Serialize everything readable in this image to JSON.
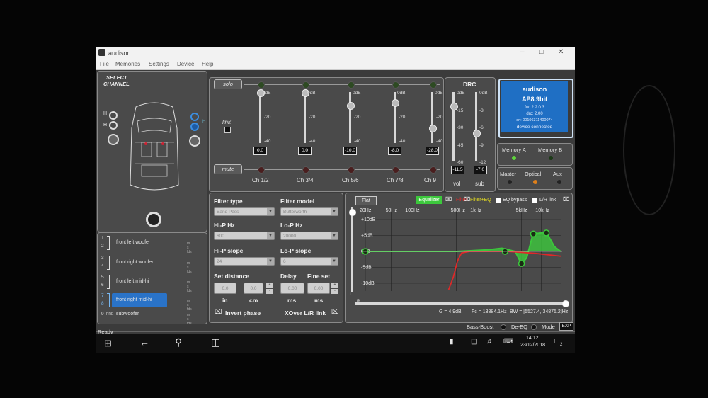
{
  "window": {
    "title": "audison"
  },
  "menu": [
    "File",
    "Memories",
    "Settings",
    "Device",
    "Help"
  ],
  "select_channel": {
    "line1": "SELECT",
    "line2": "CHANNEL"
  },
  "car_labels": {
    "left_top": "H",
    "left_bottom": "H",
    "right": "H"
  },
  "channels": [
    {
      "num_a": "1",
      "num_b": "2",
      "name": "front left woofer",
      "badge": "m s fds"
    },
    {
      "num_a": "3",
      "num_b": "4",
      "name": "front right woofer",
      "badge": "m s fds"
    },
    {
      "num_a": "5",
      "num_b": "6",
      "name": "front left mid-hi",
      "badge": "m s fds"
    },
    {
      "num_a": "7",
      "num_b": "8",
      "name": "front right mid-hi",
      "badge": "m s fds"
    },
    {
      "num_a": "9",
      "pre": "PRE",
      "name": "subwoofer",
      "badge": "m s fds"
    }
  ],
  "mixer": {
    "solo_label": "solo",
    "link_label": "link",
    "mute_label": "mute",
    "scale": [
      "0dB",
      "-20",
      "-40"
    ],
    "faders": [
      {
        "name": "Ch 1/2",
        "value": "0.0",
        "level": 0.0
      },
      {
        "name": "Ch 3/4",
        "value": "0.0",
        "level": 0.0
      },
      {
        "name": "Ch 5/6",
        "value": "-10.0",
        "level": 0.25
      },
      {
        "name": "Ch 7/8",
        "value": "-8.0",
        "level": 0.2
      },
      {
        "name": "Ch 9",
        "value": "-28.0",
        "level": 0.7
      }
    ]
  },
  "drc": {
    "title": "DRC",
    "vol_scale": [
      "0dB",
      "-15",
      "-30",
      "-45",
      "-60"
    ],
    "sub_scale": [
      "0dB",
      "-3",
      "-6",
      "-9",
      "-12"
    ],
    "vol_value": "-11.5",
    "sub_value": "-7.0",
    "vol_label": "vol",
    "sub_label": "sub",
    "vol_level": 0.19,
    "sub_level": 0.58
  },
  "device": {
    "brand": "audison",
    "model": "AP8.9bit",
    "fw": "fw: 2.2.0.3",
    "drc": "drc: 2.00",
    "sn": "sn: 00106311400074",
    "status": "device connected",
    "bg": "#1f6fc4"
  },
  "memory": {
    "a": "Memory A",
    "b": "Memory B"
  },
  "source": {
    "master": "Master",
    "optical": "Optical",
    "aux": "Aux"
  },
  "filter": {
    "type_label": "Filter type",
    "model_label": "Filter model",
    "type_value": "Band Pass",
    "model_value": "Butterworth",
    "hip_label": "Hi-P Hz",
    "lop_label": "Lo-P Hz",
    "hip_value": "600",
    "lop_value": "20000",
    "hip_slope_label": "Hi-P slope",
    "lop_slope_label": "Lo-P slope",
    "hip_slope_value": "24",
    "lop_slope_value": "6",
    "set_distance_label": "Set distance",
    "delay_label": "Delay",
    "fine_label": "Fine set",
    "dist_in": "0.0",
    "dist_cm": "0.0",
    "delay_ms": "0.00",
    "fine_ms": "0.00",
    "unit_in": "in",
    "unit_cm": "cm",
    "unit_ms1": "ms",
    "unit_ms2": "ms",
    "invert_label": "Invert phase",
    "xover_label": "XOver L/R link"
  },
  "eq": {
    "flat_label": "Flat",
    "equalizer_label": "Equalizer",
    "filter_label": "Filter",
    "filter_eq_label": "Filter+EQ",
    "eq_bypass_label": "EQ bypass",
    "lr_link_label": "L/R link",
    "freq_labels": [
      "20Hz",
      "50Hz",
      "100Hz",
      "500Hz",
      "1kHz",
      "5kHz",
      "10kHz"
    ],
    "db_labels": [
      "+10dB",
      "+5dB",
      "0dB",
      "-5dB",
      "-10dB"
    ],
    "readout_g": "G = 4.9dB",
    "readout_fc": "Fc = 13884.1Hz",
    "readout_bw": "BW = [5527.4, 34875.2]Hz",
    "left_marker": "L",
    "right_marker": "R",
    "colors": {
      "eq": "#3cc83c",
      "filter": "#e02828",
      "filter_eq": "#e8e020"
    }
  },
  "bottom": {
    "bass_boost": "Bass-Boost",
    "de_eq": "De-EQ",
    "mode": "Mode",
    "exp": "EXP"
  },
  "status": {
    "text": "Ready"
  },
  "taskbar": {
    "time": "14:12",
    "date": "23/12/2018",
    "notif": "2"
  }
}
